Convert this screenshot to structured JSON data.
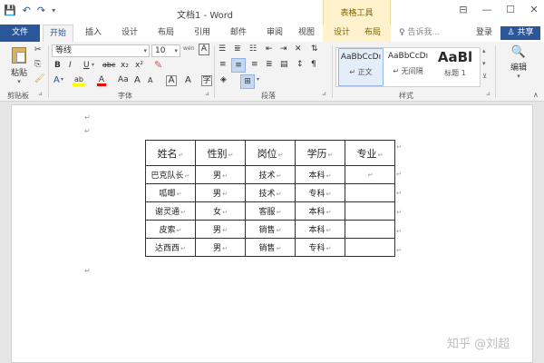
{
  "titlebar": {
    "save_icon": "💾",
    "undo_icon": "↶",
    "redo_icon": "↷",
    "customize_icon": "▾",
    "doc_title": "文档1 - Word",
    "context_tab": "表格工具",
    "ribbon_display_icon": "⊟",
    "minimize": "—",
    "maximize": "☐",
    "close": "✕"
  },
  "tabs": {
    "file": "文件",
    "items": [
      "开始",
      "插入",
      "设计",
      "布局",
      "引用",
      "邮件",
      "审阅",
      "视图"
    ],
    "context_items": [
      "设计",
      "布局"
    ],
    "search": "告诉我...",
    "login": "登录",
    "share": "共享"
  },
  "ribbon": {
    "clipboard": {
      "paste": "粘贴",
      "label": "剪贴板"
    },
    "font": {
      "name": "等线",
      "size": "10",
      "label": "字体",
      "wen": "wén",
      "bold": "B",
      "italic": "I",
      "underline": "U",
      "strike": "abc",
      "sub": "x₂",
      "sup": "x²",
      "grow": "A",
      "shrink": "A",
      "case": "Aa",
      "clear": "A",
      "highlight": "ab",
      "color": "A",
      "charborder": "A"
    },
    "paragraph": {
      "label": "段落"
    },
    "styles": {
      "label": "样式",
      "items": [
        {
          "preview": "AaBbCcDı",
          "name": "↵ 正文"
        },
        {
          "preview": "AaBbCcDı",
          "name": "↵ 无间隔"
        },
        {
          "preview": "AaBl",
          "name": "标题 1"
        }
      ]
    },
    "editing": {
      "label": "编辑",
      "find_icon": "🔍"
    }
  },
  "document": {
    "para_mark": "↵",
    "headers": [
      "姓名",
      "性别",
      "岗位",
      "学历",
      "专业"
    ],
    "rows": [
      [
        "巴克队长",
        "男",
        "技术",
        "本科",
        ""
      ],
      [
        "呱唧",
        "男",
        "技术",
        "专科",
        ""
      ],
      [
        "谢灵通",
        "女",
        "客服",
        "本科",
        ""
      ],
      [
        "皮索",
        "男",
        "销售",
        "本科",
        ""
      ],
      [
        "达西西",
        "男",
        "销售",
        "专科",
        ""
      ]
    ],
    "watermark": "知乎 @刘超"
  }
}
